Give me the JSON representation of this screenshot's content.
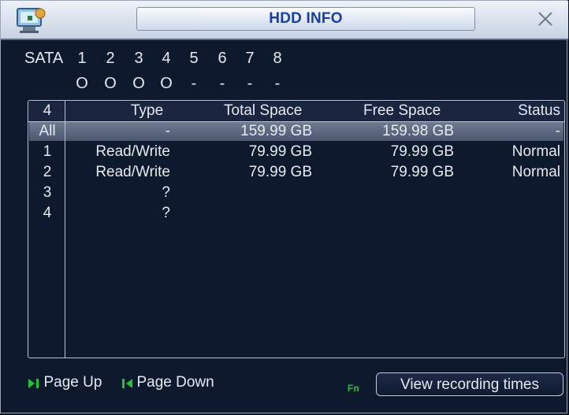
{
  "window": {
    "title": "HDD INFO",
    "title_icon": "hdd-monitor-icon",
    "close_icon": "close-icon"
  },
  "sata": {
    "label": "SATA",
    "ports": [
      "1",
      "2",
      "3",
      "4",
      "5",
      "6",
      "7",
      "8"
    ],
    "states": [
      "O",
      "O",
      "O",
      "O",
      "-",
      "-",
      "-",
      "-"
    ]
  },
  "table": {
    "headers": {
      "index": "4",
      "type": "Type",
      "total": "Total Space",
      "free": "Free Space",
      "status": "Status"
    },
    "rows": [
      {
        "index": "All",
        "type": "-",
        "total": "159.99 GB",
        "free": "159.98 GB",
        "status": "-"
      },
      {
        "index": "1",
        "type": "Read/Write",
        "total": "79.99 GB",
        "free": "79.99 GB",
        "status": "Normal"
      },
      {
        "index": "2",
        "type": "Read/Write",
        "total": "79.99 GB",
        "free": "79.99 GB",
        "status": "Normal"
      },
      {
        "index": "3",
        "type": "?",
        "total": "",
        "free": "",
        "status": ""
      },
      {
        "index": "4",
        "type": "?",
        "total": "",
        "free": "",
        "status": ""
      }
    ]
  },
  "footer": {
    "page_up": "Page Up",
    "page_down": "Page Down",
    "fn_label": "Fn",
    "view_button": "View recording times"
  },
  "colors": {
    "background": "#0d1a2e",
    "title_text": "#163ea8",
    "selected_row": "#5d6980",
    "fn_green": "#22c13b"
  }
}
